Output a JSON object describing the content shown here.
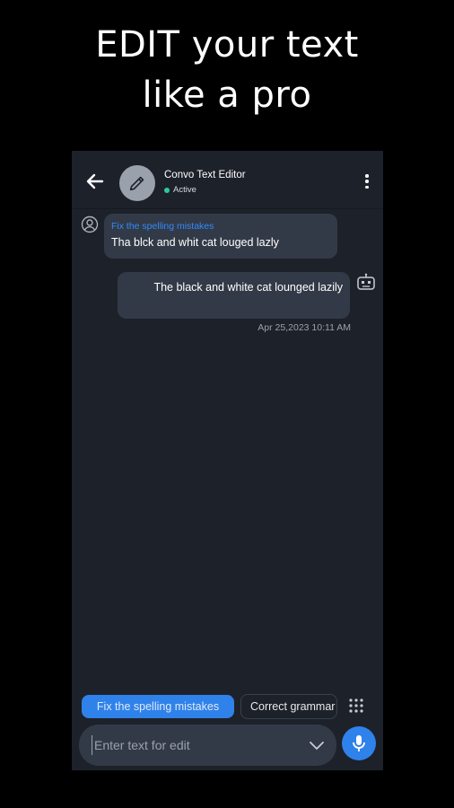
{
  "headline": {
    "line1": "EDIT your text",
    "line2": "like a pro"
  },
  "header": {
    "title": "Convo Text Editor",
    "status": "Active"
  },
  "messages": {
    "incoming": {
      "command": "Fix the spelling mistakes",
      "text": "Tha blck and whit cat louged lazly"
    },
    "outgoing": {
      "text": "The black and white cat lounged lazily",
      "timestamp": "Apr 25,2023 10:11 AM"
    }
  },
  "chips": [
    {
      "label": "Fix the spelling mistakes"
    },
    {
      "label": "Correct grammar"
    }
  ],
  "input": {
    "placeholder": "Enter text for edit",
    "value": ""
  },
  "colors": {
    "accent": "#2f82ea",
    "background": "#1d212a",
    "bubble": "#333a47",
    "status_dot": "#2ccb9a"
  },
  "icons": {
    "back": "back-arrow-icon",
    "avatar": "pencil-icon",
    "menu": "more-vert-icon",
    "user": "user-icon",
    "bot": "robot-icon",
    "grid": "grid-icon",
    "dropdown": "chevron-down-icon",
    "mic": "mic-icon"
  }
}
